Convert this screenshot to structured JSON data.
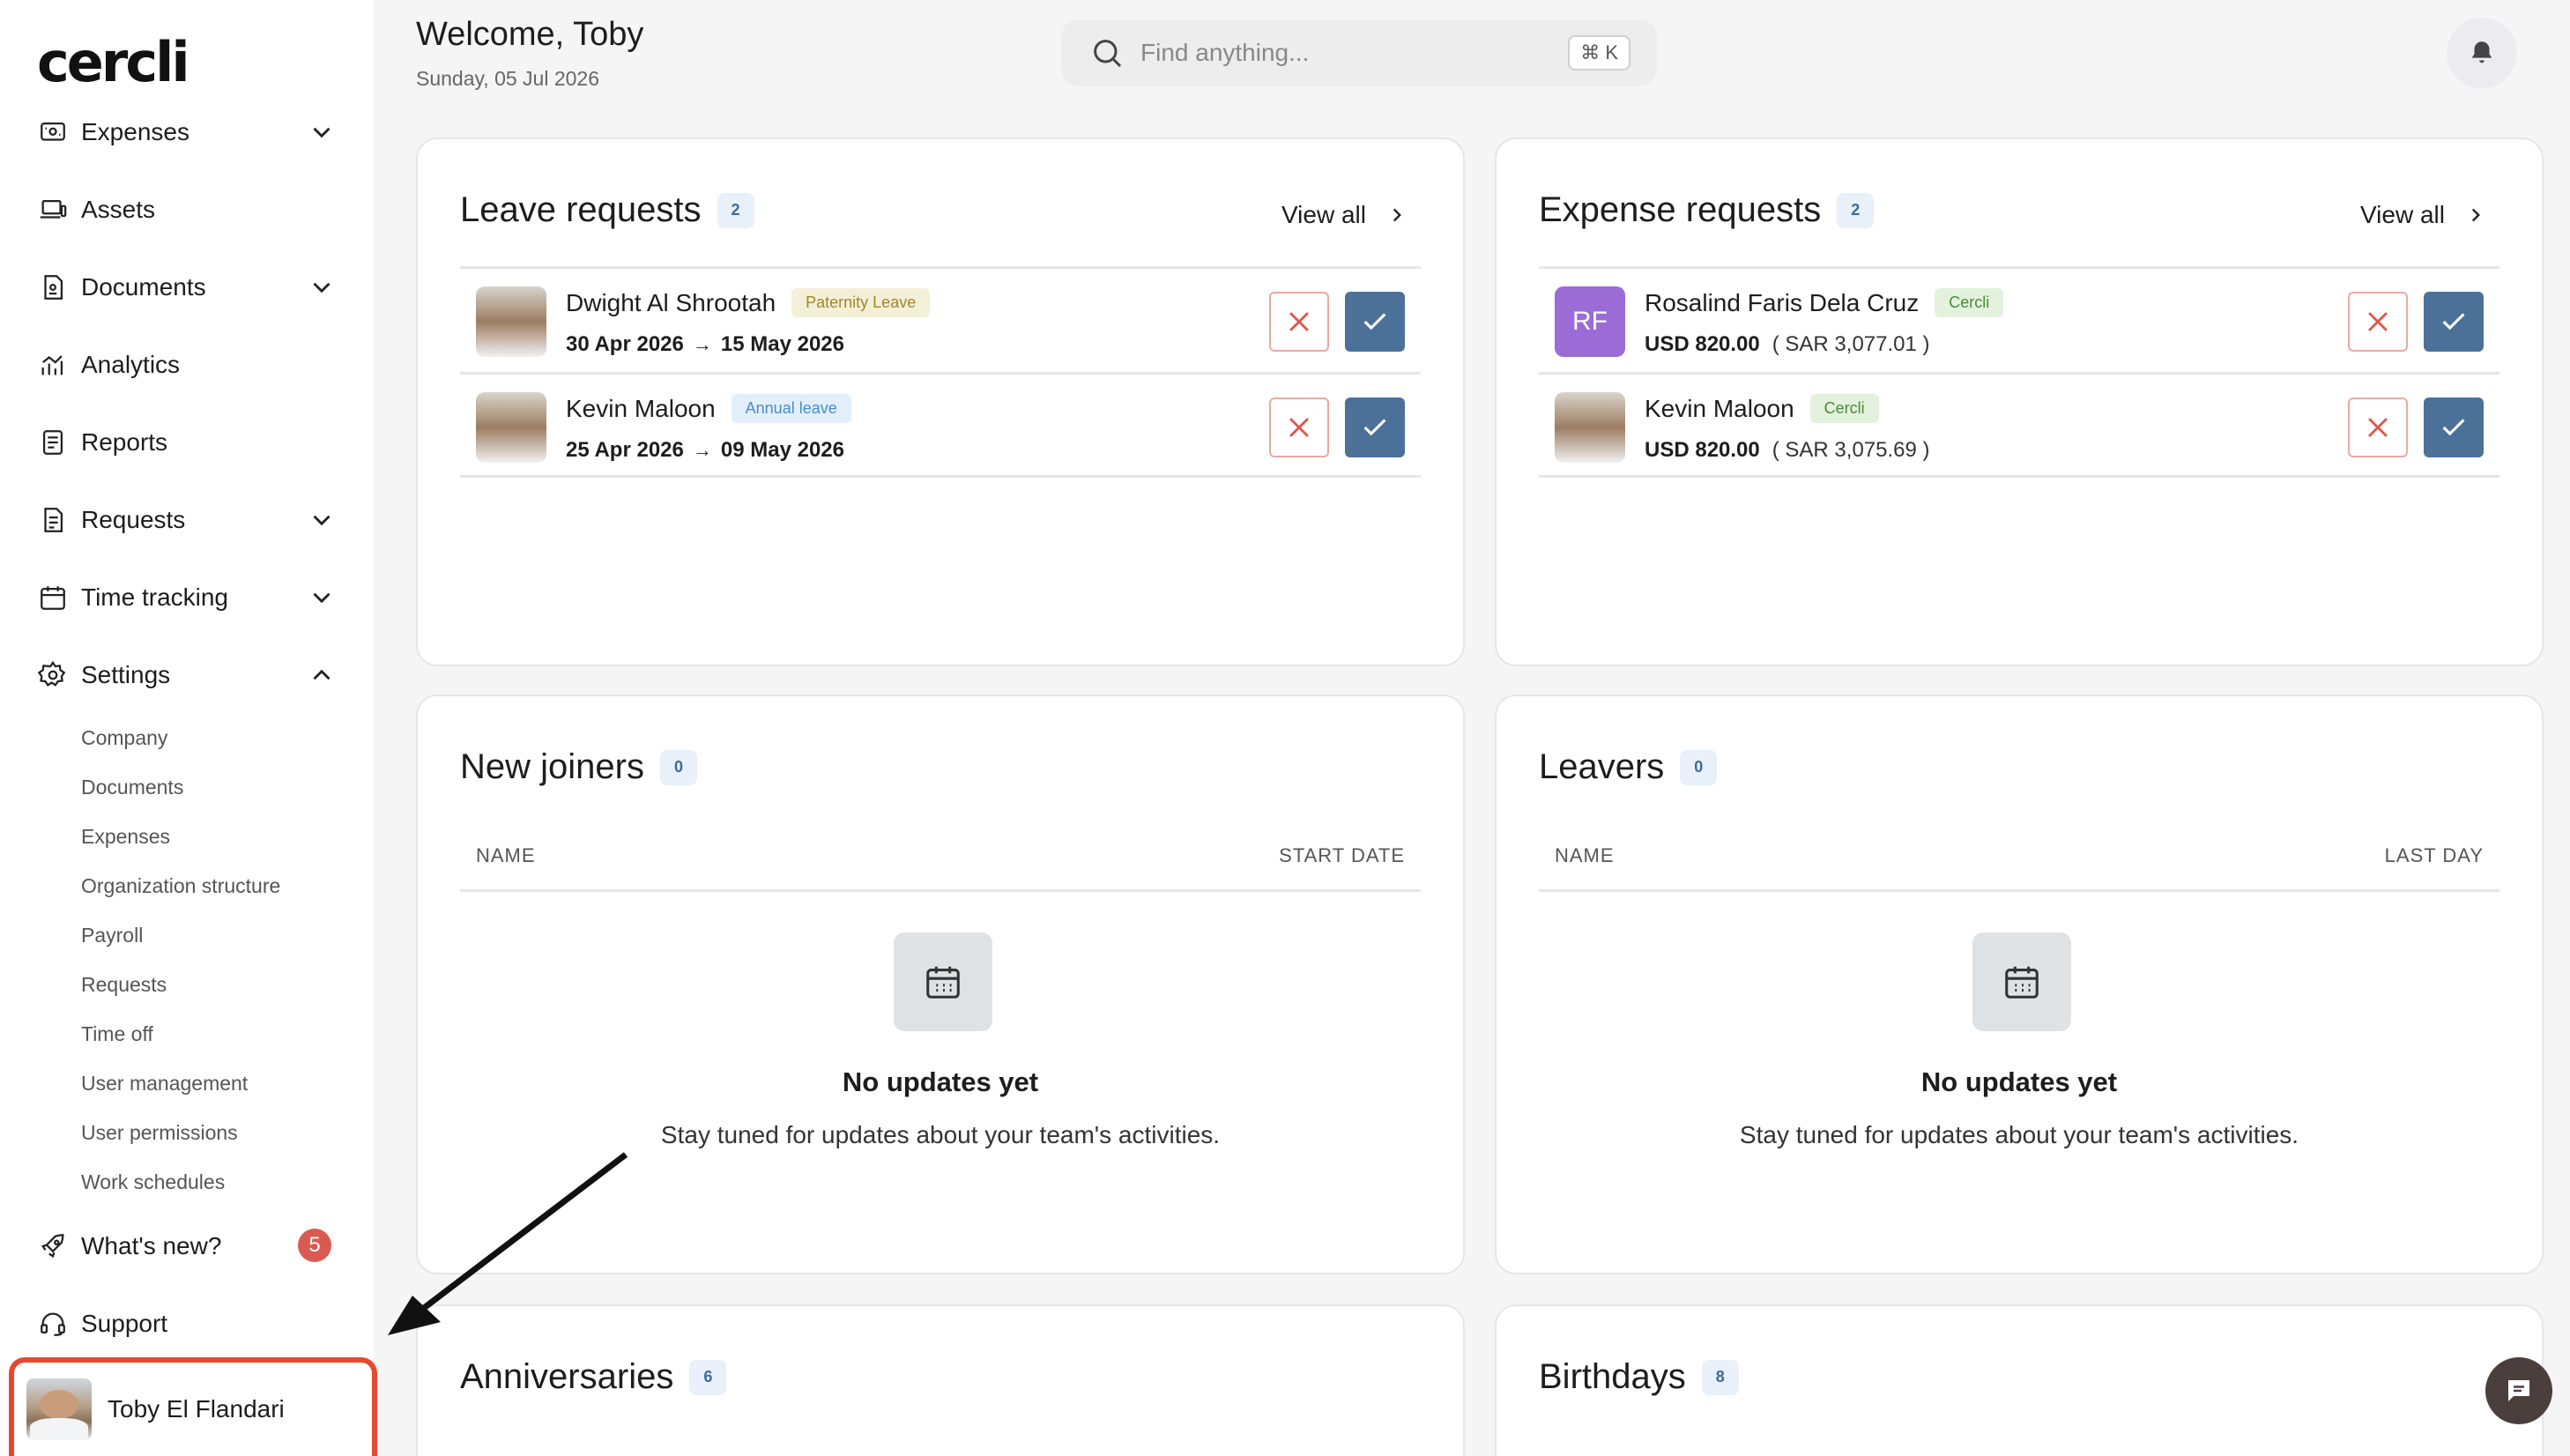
{
  "app": {
    "logo": "cercli"
  },
  "header": {
    "welcome": "Welcome, Toby",
    "date": "Sunday, 05 Jul 2026",
    "search_placeholder": "Find anything...",
    "shortcut": "⌘ K"
  },
  "sidebar": {
    "items": [
      {
        "label": "Expenses",
        "icon": "receipt-icon",
        "expandable": true
      },
      {
        "label": "Assets",
        "icon": "laptop-icon",
        "expandable": false
      },
      {
        "label": "Documents",
        "icon": "document-icon",
        "expandable": true
      },
      {
        "label": "Analytics",
        "icon": "analytics-icon",
        "expandable": false
      },
      {
        "label": "Reports",
        "icon": "report-icon",
        "expandable": false
      },
      {
        "label": "Requests",
        "icon": "requests-icon",
        "expandable": true
      },
      {
        "label": "Time tracking",
        "icon": "calendar-icon",
        "expandable": true
      },
      {
        "label": "Settings",
        "icon": "gear-icon",
        "expandable": true,
        "expanded": true
      }
    ],
    "settings_sub": [
      "Company",
      "Documents",
      "Expenses",
      "Organization structure",
      "Payroll",
      "Requests",
      "Time off",
      "User management",
      "User permissions",
      "Work schedules"
    ],
    "whats_new": {
      "label": "What's new?",
      "badge": "5"
    },
    "support": "Support",
    "user": {
      "name": "Toby El Flandari"
    }
  },
  "cards": {
    "leave": {
      "title": "Leave requests",
      "count": "2",
      "view_all": "View all",
      "rows": [
        {
          "name": "Dwight Al Shrootah",
          "tag": "Paternity Leave",
          "from": "30 Apr 2026",
          "to": "15 May 2026"
        },
        {
          "name": "Kevin Maloon",
          "tag": "Annual leave",
          "from": "25 Apr 2026",
          "to": "09 May 2026"
        }
      ]
    },
    "expense": {
      "title": "Expense requests",
      "count": "2",
      "view_all": "View all",
      "rows": [
        {
          "initials": "RF",
          "name": "Rosalind Faris Dela Cruz",
          "tag": "Cercli",
          "amount": "USD 820.00",
          "converted": "( SAR 3,077.01 )"
        },
        {
          "name": "Kevin Maloon",
          "tag": "Cercli",
          "amount": "USD 820.00",
          "converted": "( SAR 3,075.69 )"
        }
      ]
    },
    "joiners": {
      "title": "New joiners",
      "count": "0",
      "col_left": "NAME",
      "col_right": "START DATE",
      "empty_title": "No updates yet",
      "empty_sub": "Stay tuned for updates about your team's activities."
    },
    "leavers": {
      "title": "Leavers",
      "count": "0",
      "col_left": "NAME",
      "col_right": "LAST DAY",
      "empty_title": "No updates yet",
      "empty_sub": "Stay tuned for updates about your team's activities."
    },
    "anniversaries": {
      "title": "Anniversaries",
      "count": "6"
    },
    "birthdays": {
      "title": "Birthdays",
      "count": "8"
    }
  },
  "colors": {
    "accent": "#4c7199",
    "reject_border": "#e9a9a4",
    "highlight": "#e6492f",
    "badge": "#d95a51"
  }
}
